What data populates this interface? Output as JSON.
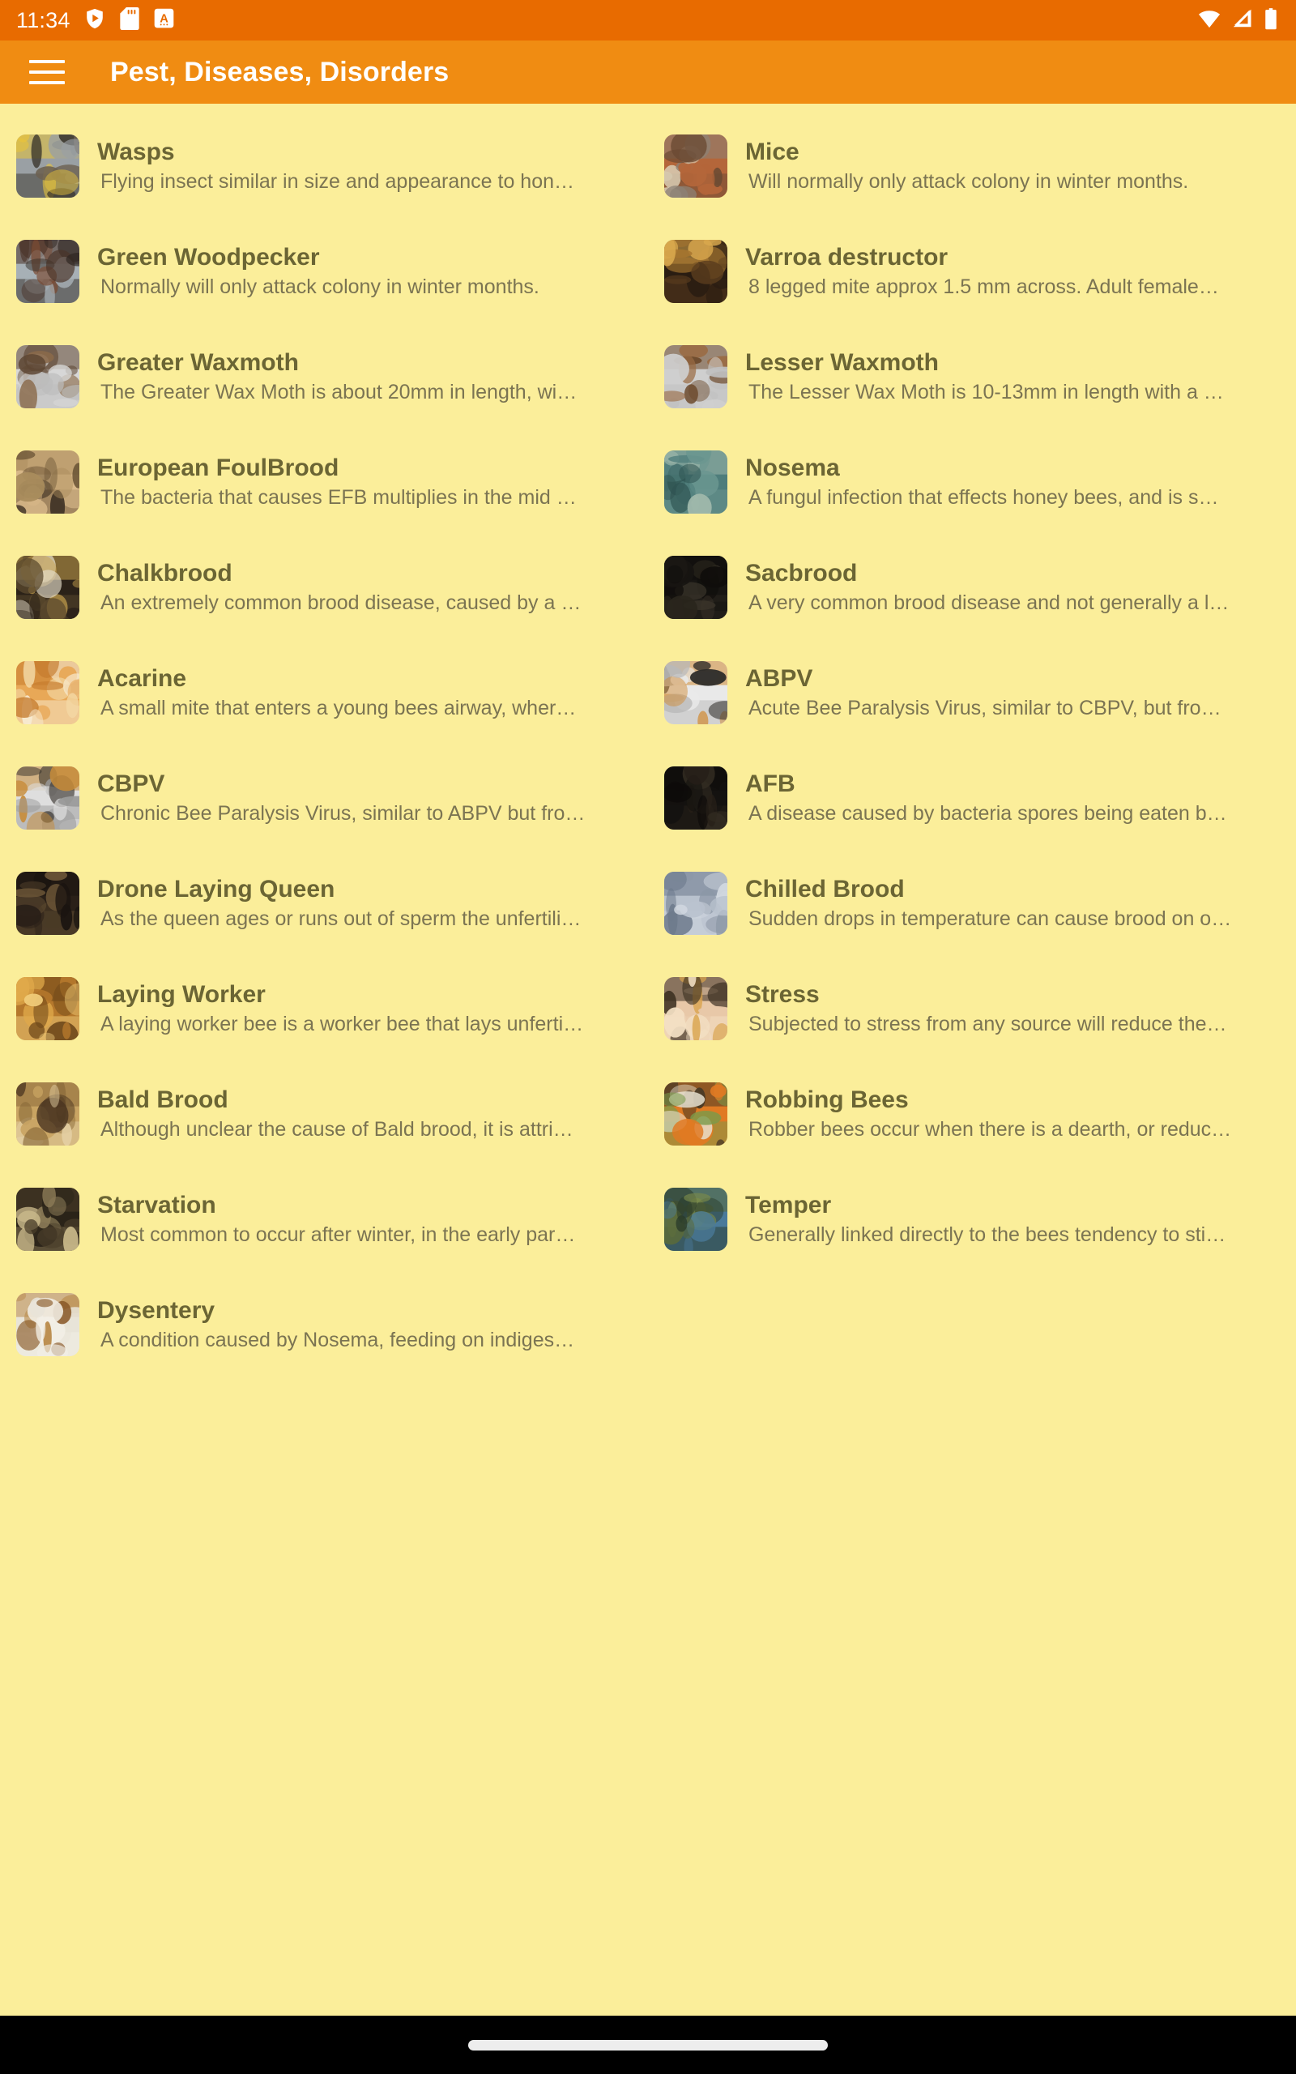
{
  "status_bar": {
    "time": "11:34",
    "left_icons": [
      "play-protect-shield-icon",
      "sd-card-icon",
      "app-badge-a-icon"
    ],
    "right_icons": [
      "wifi-icon",
      "cellular-signal-icon",
      "battery-icon"
    ],
    "background_color": "#E86B00"
  },
  "app_bar": {
    "menu_icon": "hamburger-menu-icon",
    "title": "Pest, Diseases, Disorders",
    "background_color": "#F08C12",
    "text_color": "#FFFFFF"
  },
  "theme": {
    "content_background": "#FBEE9A",
    "title_color": "#6B6534",
    "subtitle_color": "#7B7452",
    "accent": "#F08C12"
  },
  "list": {
    "items": [
      {
        "title": "Wasps",
        "subtitle": "Flying insect similar in size and appearance to hon…",
        "thumb": "wasps-photo"
      },
      {
        "title": "Mice",
        "subtitle": "Will normally only attack colony in winter months.",
        "thumb": "mouse-photo"
      },
      {
        "title": "Green Woodpecker",
        "subtitle": "Normally will only attack colony in winter months.",
        "thumb": "woodpecker-damage-photo"
      },
      {
        "title": "Varroa destructor",
        "subtitle": "8 legged mite approx 1.5 mm across. Adult female…",
        "thumb": "varroa-mite-photo"
      },
      {
        "title": "Greater Waxmoth",
        "subtitle": "The Greater Wax Moth is about 20mm in length, wi…",
        "thumb": "greater-waxmoth-photo"
      },
      {
        "title": "Lesser Waxmoth",
        "subtitle": "The Lesser Wax Moth is 10-13mm in length with a …",
        "thumb": "lesser-waxmoth-photo"
      },
      {
        "title": "European FoulBrood",
        "subtitle": "The bacteria that causes EFB multiplies in the mid …",
        "thumb": "efb-comb-photo"
      },
      {
        "title": "Nosema",
        "subtitle": "A fungul infection that effects honey bees, and is s…",
        "thumb": "nosema-photo"
      },
      {
        "title": "Chalkbrood",
        "subtitle": "An extremely common brood disease, caused by a …",
        "thumb": "chalkbrood-photo"
      },
      {
        "title": "Sacbrood",
        "subtitle": "A very common brood disease and not generally a l…",
        "thumb": "sacbrood-comb-photo"
      },
      {
        "title": "Acarine",
        "subtitle": "A small mite that enters a young bees airway, wher…",
        "thumb": "acarine-photo"
      },
      {
        "title": "ABPV",
        "subtitle": "Acute Bee Paralysis Virus, similar to CBPV, but fro…",
        "thumb": "abpv-bees-photo"
      },
      {
        "title": "CBPV",
        "subtitle": "Chronic Bee Paralysis Virus, similar to ABPV but fro…",
        "thumb": "cbpv-bees-photo"
      },
      {
        "title": "AFB",
        "subtitle": "A disease caused by bacteria spores being eaten b…",
        "thumb": "afb-comb-photo"
      },
      {
        "title": "Drone Laying Queen",
        "subtitle": "As the queen ages or runs out of sperm the unfertili…",
        "thumb": "drone-laying-queen-photo"
      },
      {
        "title": "Chilled Brood",
        "subtitle": "Sudden drops in temperature can cause brood on o…",
        "thumb": "chilled-brood-photo"
      },
      {
        "title": "Laying Worker",
        "subtitle": "A laying worker bee is a worker bee that lays unferti…",
        "thumb": "laying-worker-photo"
      },
      {
        "title": "Stress",
        "subtitle": "Subjected to stress from any source will reduce the…",
        "thumb": "stress-bee-photo"
      },
      {
        "title": "Bald Brood",
        "subtitle": "Although unclear the cause of Bald brood, it is attri…",
        "thumb": "bald-brood-photo"
      },
      {
        "title": "Robbing Bees",
        "subtitle": "Robber bees occur when there is a dearth, or reduc…",
        "thumb": "robbing-bees-photo"
      },
      {
        "title": "Starvation",
        "subtitle": "Most common to occur after winter, in the early par…",
        "thumb": "starvation-comb-photo"
      },
      {
        "title": "Temper",
        "subtitle": "Generally linked directly to the bees tendency to sti…",
        "thumb": "temper-beekeeper-photo"
      },
      {
        "title": "Dysentery",
        "subtitle": "A condition caused by Nosema, feeding on indiges…",
        "thumb": "dysentery-hive-photo"
      }
    ]
  },
  "nav_bar": {
    "gesture_pill": "home-gesture-pill"
  }
}
